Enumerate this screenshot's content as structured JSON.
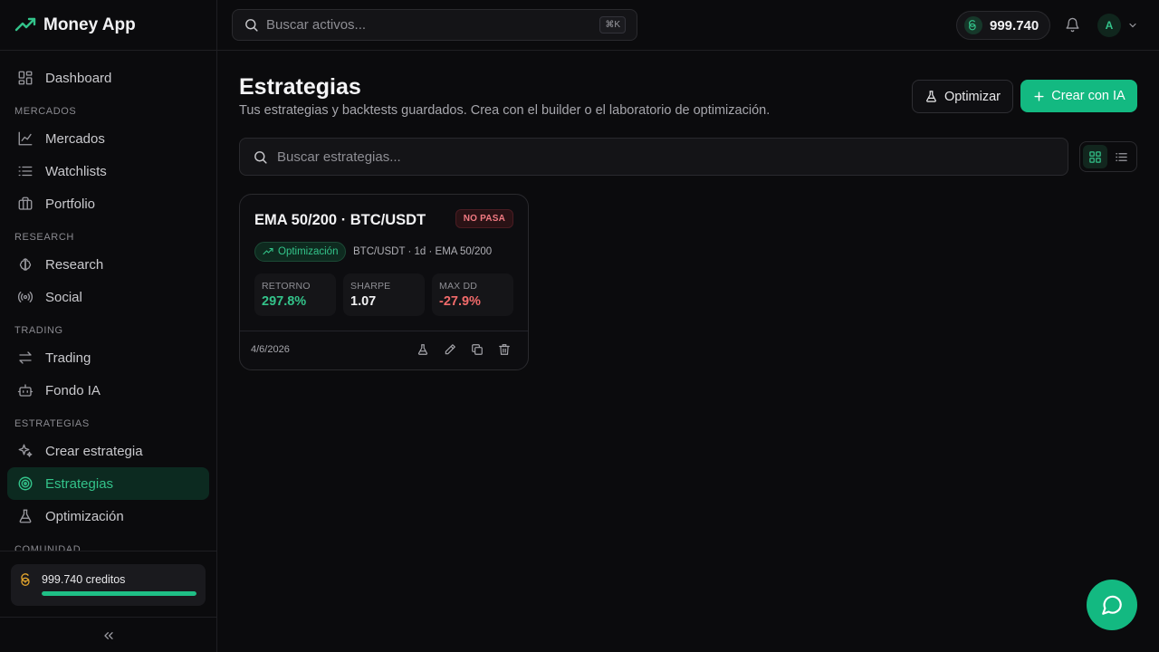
{
  "brand": {
    "name": "Money App"
  },
  "topbar": {
    "search_placeholder": "Buscar activos...",
    "shortcut": "⌘K",
    "balance": "999.740",
    "avatar_initial": "A"
  },
  "sidebar": {
    "dashboard": "Dashboard",
    "sections": {
      "mercados": "MERCADOS",
      "research": "RESEARCH",
      "trading": "TRADING",
      "estrategias": "ESTRATEGIAS",
      "comunidad": "COMUNIDAD"
    },
    "items": {
      "mercados": "Mercados",
      "watchlists": "Watchlists",
      "portfolio": "Portfolio",
      "research": "Research",
      "social": "Social",
      "trading": "Trading",
      "fondo_ia": "Fondo IA",
      "crear_estrategia": "Crear estrategia",
      "estrategias": "Estrategias",
      "optimizacion": "Optimización"
    },
    "credits_label": "999.740 creditos",
    "credits_fraction": 1.0
  },
  "main": {
    "title": "Estrategias",
    "subtitle": "Tus estrategias y backtests guardados. Crea con el builder o el laboratorio de optimización.",
    "optimize_label": "Optimizar",
    "create_label": "Crear con IA",
    "search_placeholder": "Buscar estrategias..."
  },
  "cards": [
    {
      "title": "EMA 50/200 · BTC/USDT",
      "badge": "NO PASA",
      "tag": "Optimización",
      "meta": "BTC/USDT · 1d  · EMA 50/200",
      "metrics": {
        "retorno_label": "RETORNO",
        "retorno_value": "297.8%",
        "sharpe_label": "SHARPE",
        "sharpe_value": "1.07",
        "maxdd_label": "MAX DD",
        "maxdd_value": "-27.9%"
      },
      "date": "4/6/2026"
    }
  ],
  "colors": {
    "accent": "#13b981",
    "positive": "#33c38a",
    "negative": "#f06a6a",
    "background": "#0b0b0d"
  }
}
